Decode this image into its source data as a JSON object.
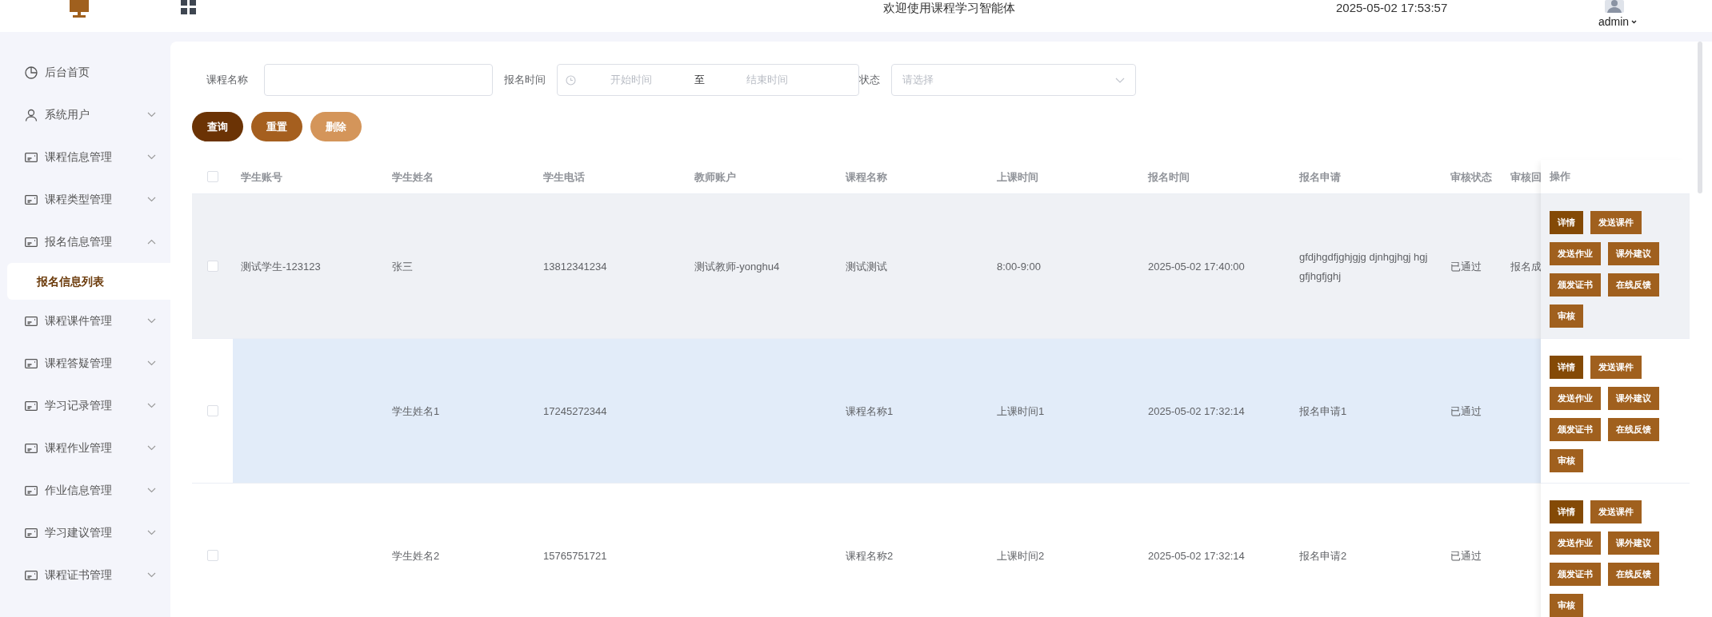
{
  "topbar": {
    "title": "欢迎使用课程学习智能体",
    "datetime": "2025-05-02 17:53:57",
    "user": "admin"
  },
  "sidebar": {
    "items": [
      {
        "label": "后台首页",
        "kind": "dashboard"
      },
      {
        "label": "系统用户",
        "kind": "user",
        "expanded": false
      },
      {
        "label": "课程信息管理",
        "kind": "module",
        "expanded": false
      },
      {
        "label": "课程类型管理",
        "kind": "module",
        "expanded": false
      },
      {
        "label": "报名信息管理",
        "kind": "module",
        "expanded": true,
        "children": [
          {
            "label": "报名信息列表",
            "selected": true
          }
        ]
      },
      {
        "label": "课程课件管理",
        "kind": "module",
        "expanded": false
      },
      {
        "label": "课程答疑管理",
        "kind": "module",
        "expanded": false
      },
      {
        "label": "学习记录管理",
        "kind": "module",
        "expanded": false
      },
      {
        "label": "课程作业管理",
        "kind": "module",
        "expanded": false
      },
      {
        "label": "作业信息管理",
        "kind": "module",
        "expanded": false
      },
      {
        "label": "学习建议管理",
        "kind": "module",
        "expanded": false
      },
      {
        "label": "课程证书管理",
        "kind": "module",
        "expanded": false
      }
    ]
  },
  "filters": [
    {
      "kind": "text",
      "label": "课程名称"
    },
    {
      "kind": "daterange",
      "label": "报名时间",
      "start_placeholder": "开始时间",
      "separator": "至",
      "end_placeholder": "结束时间"
    },
    {
      "kind": "select",
      "label": "状态",
      "placeholder": "请选择"
    }
  ],
  "buttons": [
    {
      "label": "查询",
      "kind": "primary"
    },
    {
      "label": "重置",
      "kind": "secondary"
    },
    {
      "label": "删除",
      "kind": "danger"
    }
  ],
  "table": {
    "all_checked": false,
    "columns": [
      "学生账号",
      "学生姓名",
      "学生电话",
      "教师账户",
      "课程名称",
      "上课时间",
      "报名时间",
      "报名申请",
      "审核状态",
      "审核回",
      "操作"
    ],
    "rows": [
      {
        "checked": false,
        "striped": true,
        "hovered": false,
        "cells": [
          "测试学生-123123",
          "张三",
          "13812341234",
          "测试教师-yonghu4",
          "测试测试",
          "8:00-9:00",
          "2025-05-02 17:40:00",
          "gfdjhgdfjghjgjg djnhgjhgj hgj gfjhgfjghj",
          "已通过",
          "报名成"
        ],
        "actions": [
          {
            "label": "详情",
            "kind": "primary"
          },
          {
            "label": "发送课件",
            "kind": "normal"
          },
          {
            "label": "发送作业",
            "kind": "normal"
          },
          {
            "label": "课外建议",
            "kind": "normal"
          },
          {
            "label": "颁发证书",
            "kind": "normal"
          },
          {
            "label": "在线反馈",
            "kind": "normal"
          },
          {
            "label": "审核",
            "kind": "normal"
          }
        ]
      },
      {
        "checked": false,
        "striped": false,
        "hovered": true,
        "cells": [
          null,
          "学生姓名1",
          "17245272344",
          null,
          "课程名称1",
          "上课时间1",
          "2025-05-02 17:32:14",
          "报名申请1",
          "已通过",
          null
        ],
        "actions": [
          {
            "label": "详情",
            "kind": "primary"
          },
          {
            "label": "发送课件",
            "kind": "normal"
          },
          {
            "label": "发送作业",
            "kind": "normal"
          },
          {
            "label": "课外建议",
            "kind": "normal"
          },
          {
            "label": "颁发证书",
            "kind": "normal"
          },
          {
            "label": "在线反馈",
            "kind": "normal"
          },
          {
            "label": "审核",
            "kind": "normal"
          }
        ]
      },
      {
        "checked": false,
        "striped": false,
        "hovered": false,
        "cells": [
          null,
          "学生姓名2",
          "15765751721",
          null,
          "课程名称2",
          "上课时间2",
          "2025-05-02 17:32:14",
          "报名申请2",
          "已通过",
          null
        ],
        "actions": [
          {
            "label": "详情",
            "kind": "primary"
          },
          {
            "label": "发送课件",
            "kind": "normal"
          },
          {
            "label": "发送作业",
            "kind": "normal"
          },
          {
            "label": "课外建议",
            "kind": "normal"
          },
          {
            "label": "颁发证书",
            "kind": "normal"
          },
          {
            "label": "在线反馈",
            "kind": "normal"
          },
          {
            "label": "审核",
            "kind": "normal"
          }
        ]
      }
    ]
  }
}
